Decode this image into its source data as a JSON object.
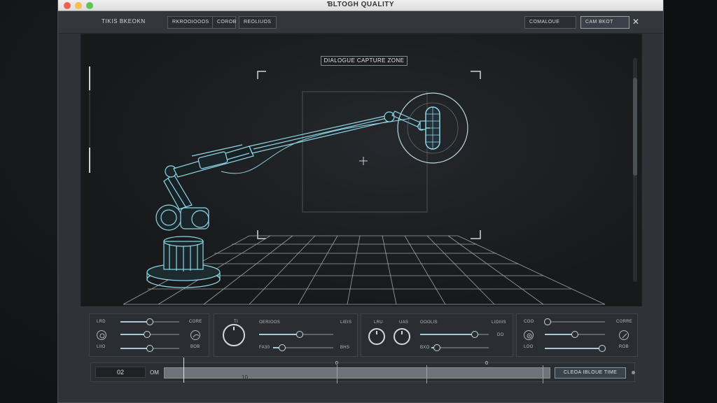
{
  "window": {
    "title": "ƁLTOGH QUALITY"
  },
  "toolbar": {
    "left_label": "TIKIS BKEOKN",
    "tab1": "RKROOIOOOS",
    "tab2": "COROB",
    "tab3": "REOLIUOS",
    "right_btn1": "COMALOUE",
    "right_btn2": "CAM BKOT"
  },
  "viewport": {
    "zone_label": "DIALOGUE CAPTURE ZONE"
  },
  "panels": {
    "p1": {
      "l1": "LRD",
      "l2": "LIIO",
      "r1": "CORE",
      "r2": "BOB",
      "s1": 0.5,
      "s2": 0.45,
      "s3": 0.5
    },
    "p2": {
      "knob_label": "TI",
      "t1": "OERIOOS",
      "t1r": "LIEIS",
      "t2": "FA30",
      "t2r": "BHS",
      "s1": 0.55,
      "s2": 0.15
    },
    "p3": {
      "k1": "LRU",
      "k2": "UAS",
      "t1": "OOOLIS",
      "t1r": "LIOIIIS",
      "t2": "BXO",
      "t2r": "DO",
      "s1": 0.8,
      "s2": 0.1
    },
    "p4": {
      "l1": "COO",
      "l2": "LOO",
      "r1": "CORRE",
      "r2": "ROB",
      "s1": 0.05,
      "s2": 0.5,
      "s3": 0.95
    }
  },
  "timeline": {
    "time": "02",
    "frame": "OM",
    "start": "10",
    "mark1": "0",
    "mark2": "0",
    "button": "CLEOA IBLOUE TIME"
  }
}
